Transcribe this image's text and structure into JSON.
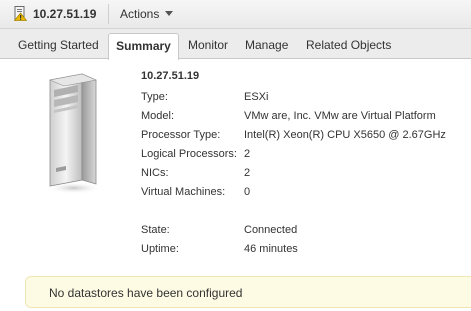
{
  "header": {
    "title": "10.27.51.19",
    "actions_label": "Actions",
    "icon": "host-alert-icon"
  },
  "tabs": [
    {
      "label": "Getting Started",
      "active": false
    },
    {
      "label": "Summary",
      "active": true
    },
    {
      "label": "Monitor",
      "active": false
    },
    {
      "label": "Manage",
      "active": false
    },
    {
      "label": "Related Objects",
      "active": false
    }
  ],
  "summary": {
    "heading": "10.27.51.19",
    "server_image": "server-tower-icon",
    "properties": [
      {
        "label": "Type:",
        "value": "ESXi"
      },
      {
        "label": "Model:",
        "value": "VMw are, Inc. VMw are Virtual Platform"
      },
      {
        "label": "Processor Type:",
        "value": "Intel(R) Xeon(R) CPU X5650 @ 2.67GHz"
      },
      {
        "label": "Logical Processors:",
        "value": "2"
      },
      {
        "label": "NICs:",
        "value": "2"
      },
      {
        "label": "Virtual Machines:",
        "value": "0"
      }
    ],
    "status": [
      {
        "label": "State:",
        "value": "Connected"
      },
      {
        "label": "Uptime:",
        "value": "46 minutes"
      }
    ]
  },
  "notice": {
    "text": "No datastores have been configured"
  },
  "colors": {
    "warning_icon": "#e8b800",
    "notice_bg": "#fdfbe3",
    "tabbar_bg": "#ececec"
  }
}
